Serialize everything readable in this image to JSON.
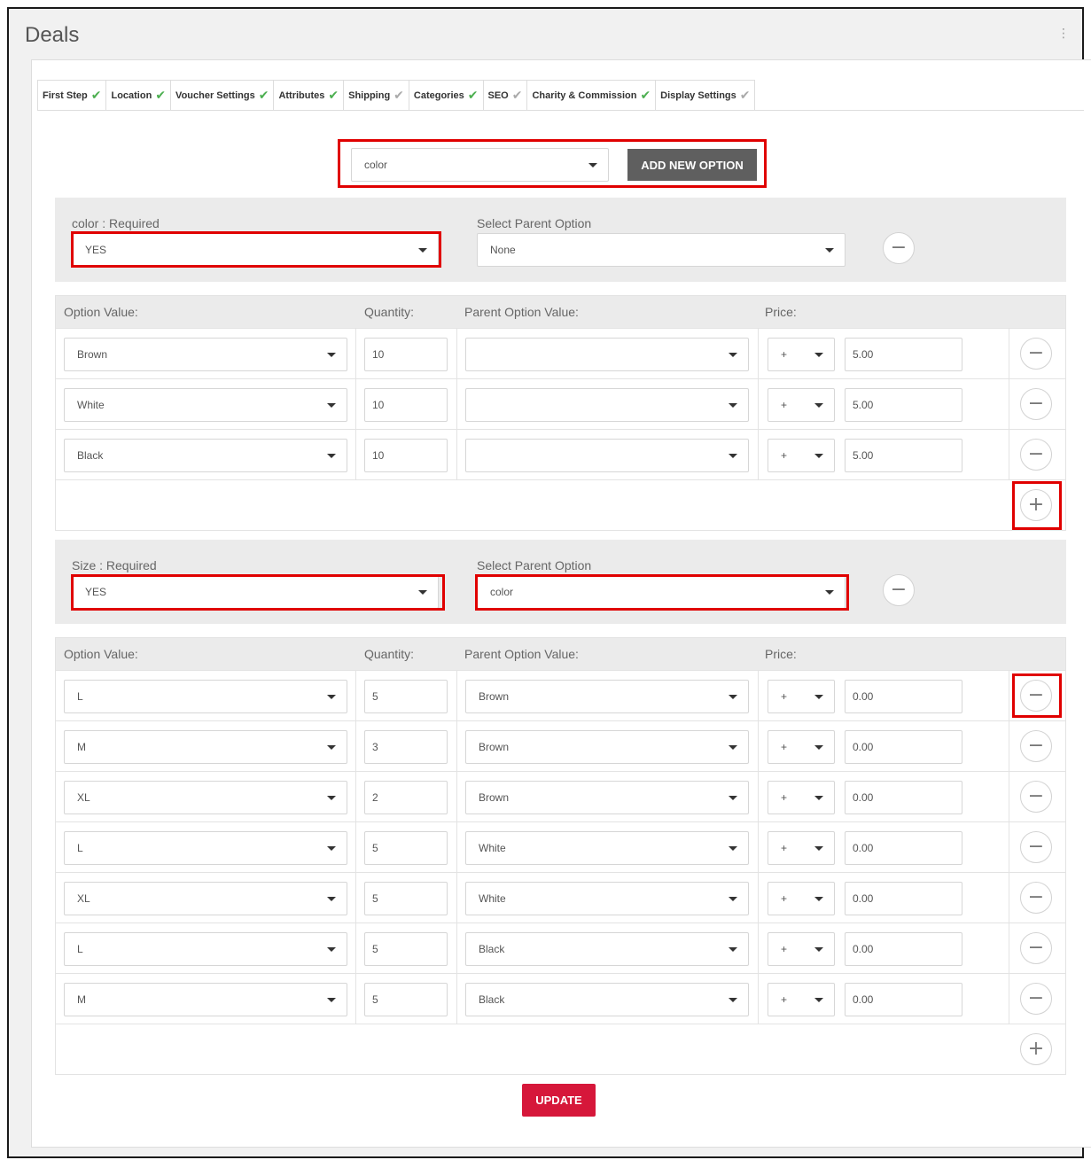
{
  "page": {
    "title": "Deals"
  },
  "tabs": [
    {
      "label": "First Step",
      "done": true
    },
    {
      "label": "Location",
      "done": true
    },
    {
      "label": "Voucher Settings",
      "done": true
    },
    {
      "label": "Attributes",
      "done": true
    },
    {
      "label": "Shipping",
      "done": false
    },
    {
      "label": "Categories",
      "done": true
    },
    {
      "label": "SEO",
      "done": false
    },
    {
      "label": "Charity & Commission",
      "done": true
    },
    {
      "label": "Display Settings",
      "done": false
    }
  ],
  "check_glyph": "✔",
  "add_option": {
    "selected": "color",
    "button_label": "ADD NEW OPTION"
  },
  "headers": {
    "option_value": "Option Value:",
    "quantity": "Quantity:",
    "parent_option_value": "Parent Option Value:",
    "price": "Price:"
  },
  "options": [
    {
      "required_label": "color : Required",
      "required_value": "YES",
      "parent_label": "Select Parent Option",
      "parent_value": "None",
      "rows": [
        {
          "value": "Brown",
          "quantity": "10",
          "parent_value": "",
          "prefix": "+",
          "price": "5.00"
        },
        {
          "value": "White",
          "quantity": "10",
          "parent_value": "",
          "prefix": "+",
          "price": "5.00"
        },
        {
          "value": "Black",
          "quantity": "10",
          "parent_value": "",
          "prefix": "+",
          "price": "5.00"
        }
      ]
    },
    {
      "required_label": "Size : Required",
      "required_value": "YES",
      "parent_label": "Select Parent Option",
      "parent_value": "color",
      "rows": [
        {
          "value": "L",
          "quantity": "5",
          "parent_value": "Brown",
          "prefix": "+",
          "price": "0.00"
        },
        {
          "value": "M",
          "quantity": "3",
          "parent_value": "Brown",
          "prefix": "+",
          "price": "0.00"
        },
        {
          "value": "XL",
          "quantity": "2",
          "parent_value": "Brown",
          "prefix": "+",
          "price": "0.00"
        },
        {
          "value": "L",
          "quantity": "5",
          "parent_value": "White",
          "prefix": "+",
          "price": "0.00"
        },
        {
          "value": "XL",
          "quantity": "5",
          "parent_value": "White",
          "prefix": "+",
          "price": "0.00"
        },
        {
          "value": "L",
          "quantity": "5",
          "parent_value": "Black",
          "prefix": "+",
          "price": "0.00"
        },
        {
          "value": "M",
          "quantity": "5",
          "parent_value": "Black",
          "prefix": "+",
          "price": "0.00"
        }
      ]
    }
  ],
  "buttons": {
    "update": "UPDATE",
    "minus_glyph": "−",
    "plus_glyph": "+"
  },
  "colors": {
    "accent_red": "#d6173a",
    "highlight_red": "#e00000",
    "check_green": "#4caf50",
    "dark_button": "#5f5f5f"
  }
}
